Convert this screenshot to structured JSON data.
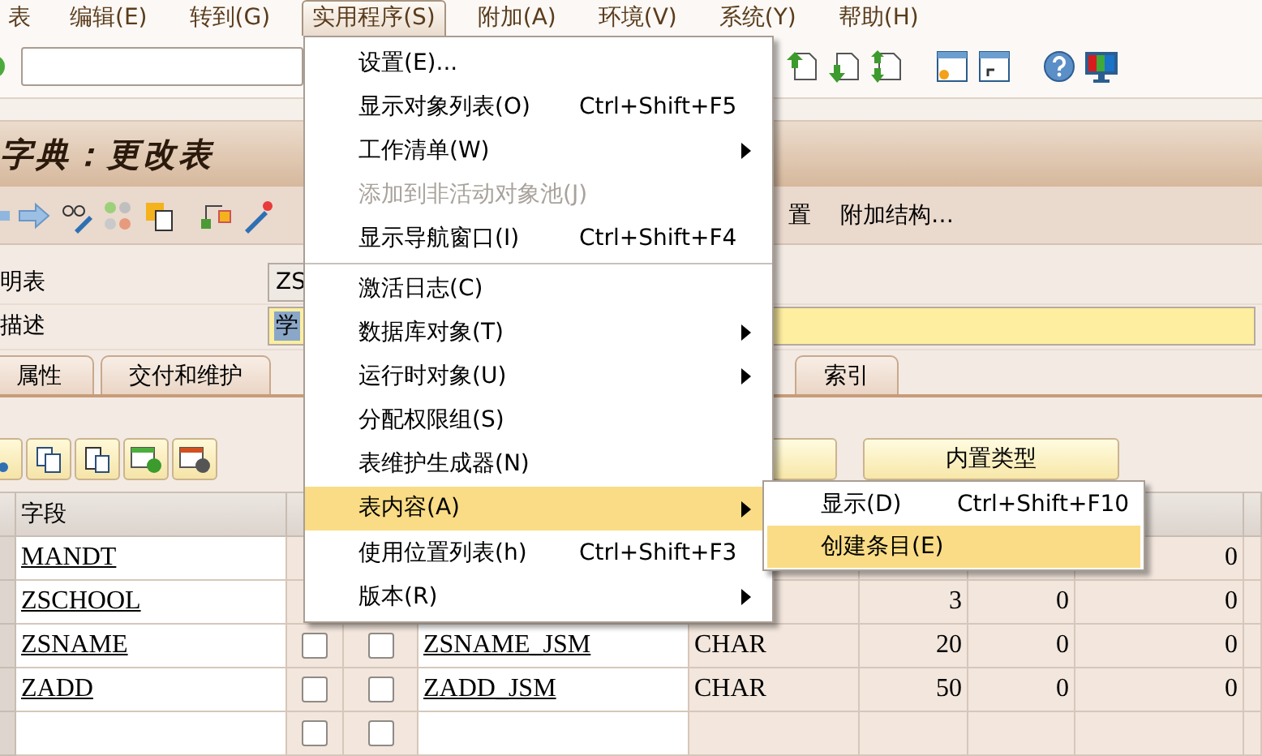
{
  "menubar": [
    {
      "label": "表",
      "selected": false
    },
    {
      "label": "编辑(E)",
      "selected": false
    },
    {
      "label": "转到(G)",
      "selected": false
    },
    {
      "label": "实用程序(S)",
      "selected": true
    },
    {
      "label": "附加(A)",
      "selected": false
    },
    {
      "label": "环境(V)",
      "selected": false
    },
    {
      "label": "系统(Y)",
      "selected": false
    },
    {
      "label": "帮助(H)",
      "selected": false
    }
  ],
  "title": "字典：更改表",
  "app_toolbar": {
    "buttons": [
      "置",
      "附加结构…"
    ]
  },
  "form": [
    {
      "label": "明表",
      "value": "ZS",
      "value_selected": false
    },
    {
      "label": "描述",
      "value": "学",
      "value_selected": true
    }
  ],
  "tabs": [
    {
      "label": "属性",
      "selected": false
    },
    {
      "label": "交付和维护",
      "selected": false
    },
    {
      "label": "索引",
      "selected": false
    }
  ],
  "table_buttons": [
    "内置类型"
  ],
  "table": {
    "column_header": "字段",
    "rows": [
      {
        "field": "MANDT",
        "decimals_2": "0"
      },
      {
        "field": "ZSCHOOL",
        "length": "3",
        "decimals": "0",
        "decimals_2": "0"
      },
      {
        "field": "ZSNAME",
        "key": false,
        "initial": false,
        "data_element": "ZSNAME_JSM",
        "data_type": "CHAR",
        "length": "20",
        "decimals": "0",
        "decimals_2": "0"
      },
      {
        "field": "ZADD",
        "key": false,
        "initial": false,
        "data_element": "ZADD_JSM",
        "data_type": "CHAR",
        "length": "50",
        "decimals": "0",
        "decimals_2": "0"
      },
      {
        "field": "",
        "key": false,
        "initial": false
      }
    ]
  },
  "menu": {
    "items": [
      {
        "kind": "item",
        "label": "设置(E)...",
        "disabled": false,
        "selected": false,
        "submenu": false
      },
      {
        "kind": "item",
        "label": "显示对象列表(O)",
        "shortcut": "Ctrl+Shift+F5",
        "disabled": false,
        "selected": false,
        "submenu": false
      },
      {
        "kind": "item",
        "label": "工作清单(W)",
        "disabled": false,
        "selected": false,
        "submenu": true
      },
      {
        "kind": "item",
        "label": "添加到非活动对象池(J)",
        "disabled": true,
        "selected": false,
        "submenu": false
      },
      {
        "kind": "item",
        "label": "显示导航窗口(I)",
        "shortcut": "Ctrl+Shift+F4",
        "disabled": false,
        "selected": false,
        "submenu": false
      },
      {
        "kind": "separator"
      },
      {
        "kind": "item",
        "label": "激活日志(C)",
        "disabled": false,
        "selected": false,
        "submenu": false
      },
      {
        "kind": "item",
        "label": "数据库对象(T)",
        "disabled": false,
        "selected": false,
        "submenu": true
      },
      {
        "kind": "item",
        "label": "运行时对象(U)",
        "disabled": false,
        "selected": false,
        "submenu": true
      },
      {
        "kind": "item",
        "label": "分配权限组(S)",
        "disabled": false,
        "selected": false,
        "submenu": false
      },
      {
        "kind": "item",
        "label": "表维护生成器(N)",
        "disabled": false,
        "selected": false,
        "submenu": false
      },
      {
        "kind": "item",
        "label": "表内容(A)",
        "disabled": false,
        "selected": true,
        "submenu": true
      },
      {
        "kind": "item",
        "label": "使用位置列表(h)",
        "shortcut": "Ctrl+Shift+F3",
        "disabled": false,
        "selected": false,
        "submenu": false
      },
      {
        "kind": "item",
        "label": "版本(R)",
        "disabled": false,
        "selected": false,
        "submenu": true
      }
    ]
  },
  "submenu": {
    "items": [
      {
        "label": "显示(D)",
        "shortcut": "Ctrl+Shift+F10",
        "selected": false
      },
      {
        "label": "创建条目(E)",
        "selected": true
      }
    ]
  }
}
